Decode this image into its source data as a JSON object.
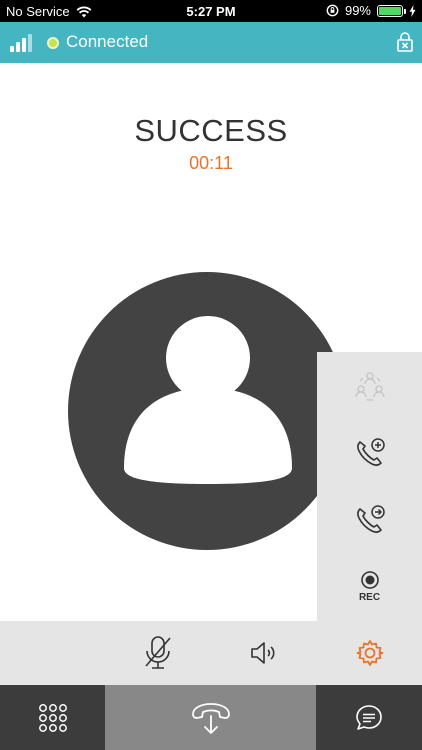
{
  "status_bar": {
    "carrier": "No Service",
    "time": "5:27 PM",
    "battery": "99%",
    "battery_level": 0.99
  },
  "connection": {
    "label": "Connected",
    "accent_color": "#45b5c2",
    "dot_color": "#c8e24a"
  },
  "call": {
    "status": "SUCCESS",
    "timer": "00:11",
    "timer_color": "#e8742c"
  },
  "side_panel": {
    "rec_label": "REC"
  },
  "icons": {
    "signal": "signal-bars-icon",
    "lock": "lock-icon",
    "conference": "conference-icon",
    "add_call": "add-call-icon",
    "transfer": "transfer-call-icon",
    "record": "record-icon",
    "mute": "microphone-muted-icon",
    "speaker": "speaker-icon",
    "settings": "gear-icon",
    "keypad": "keypad-icon",
    "hangup": "hang-up-icon",
    "chat": "chat-icon"
  }
}
